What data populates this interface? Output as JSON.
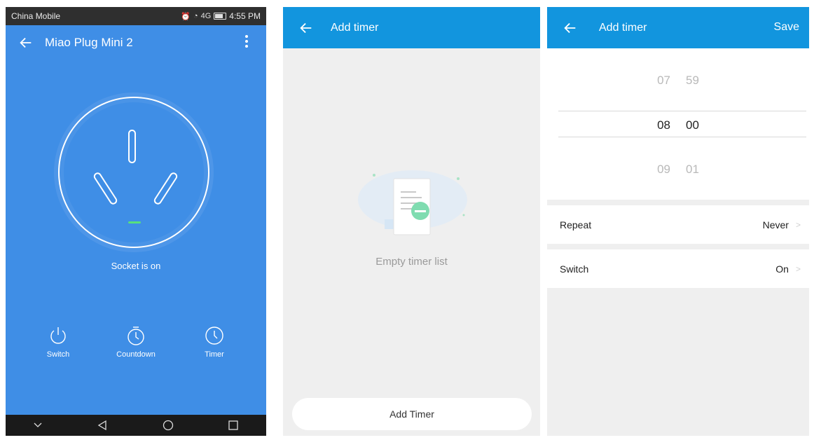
{
  "screen1": {
    "status": {
      "carrier": "China Mobile",
      "time": "4:55 PM",
      "signal": "4G"
    },
    "title": "Miao Plug Mini 2",
    "socket_status": "Socket is on",
    "actions": [
      {
        "label": "Switch",
        "icon": "power-icon"
      },
      {
        "label": "Countdown",
        "icon": "stopwatch-icon"
      },
      {
        "label": "Timer",
        "icon": "clock-icon"
      }
    ],
    "colors": {
      "background": "#3f8ee6",
      "led": "#58e07c"
    }
  },
  "screen2": {
    "title": "Add timer",
    "empty_text": "Empty timer list",
    "add_button": "Add Timer",
    "colors": {
      "appbar": "#1295de"
    }
  },
  "screen3": {
    "title": "Add timer",
    "save_label": "Save",
    "picker": {
      "above": {
        "hour": "07",
        "minute": "59"
      },
      "selected": {
        "hour": "08",
        "minute": "00"
      },
      "below": {
        "hour": "09",
        "minute": "01"
      }
    },
    "settings": [
      {
        "label": "Repeat",
        "value": "Never"
      },
      {
        "label": "Switch",
        "value": "On"
      }
    ]
  }
}
